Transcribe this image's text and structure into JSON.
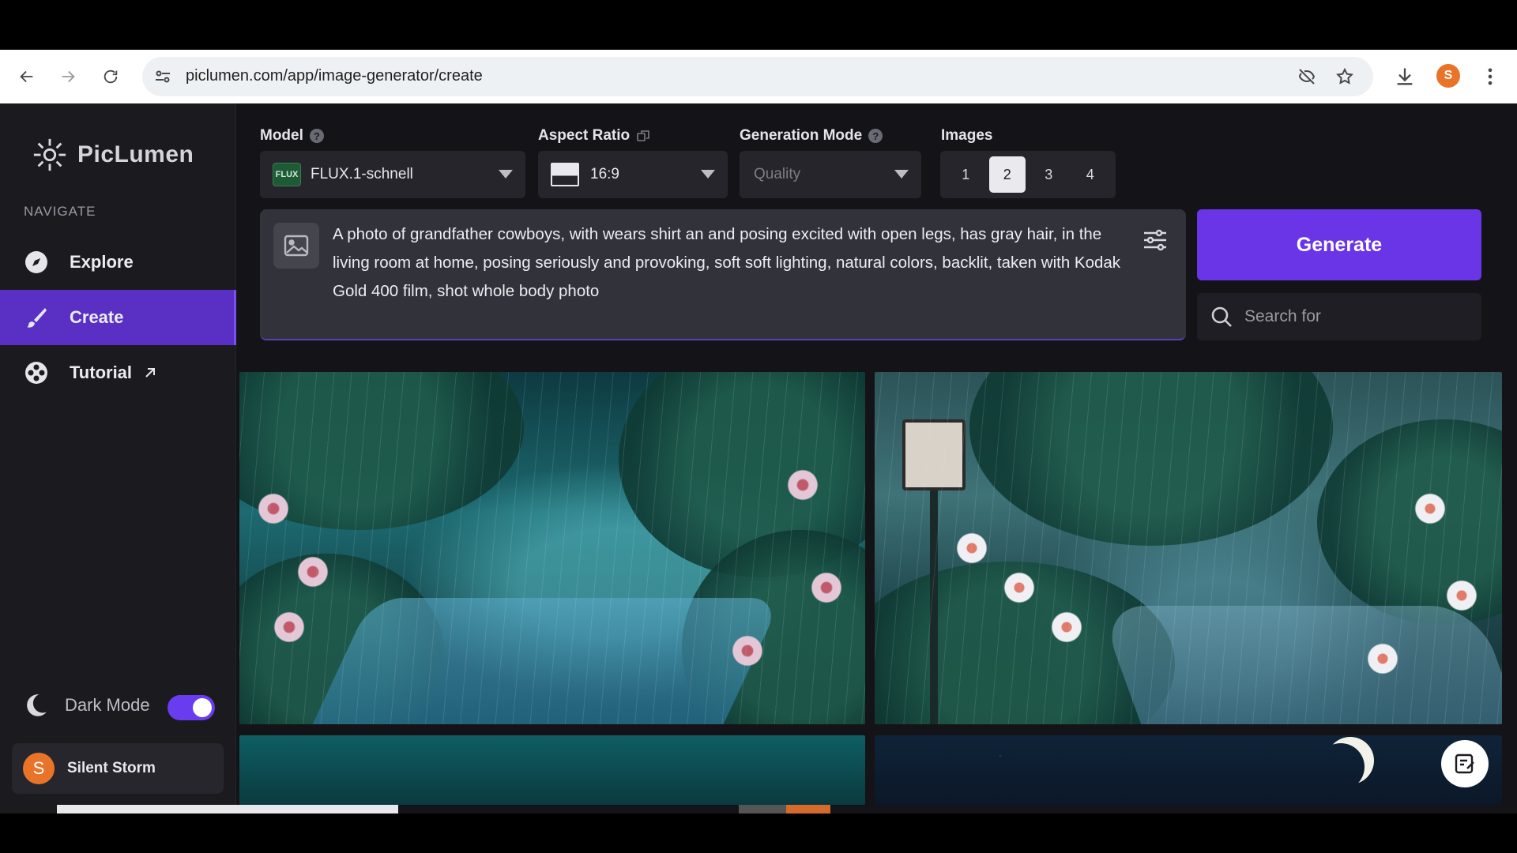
{
  "browser": {
    "url": "piclumen.com/app/image-generator/create",
    "profile_initial": "S"
  },
  "sidebar": {
    "logo_text": "PicLumen",
    "nav_heading": "NAVIGATE",
    "items": [
      {
        "label": "Explore",
        "icon": "compass-icon",
        "active": false
      },
      {
        "label": "Create",
        "icon": "brush-icon",
        "active": true
      },
      {
        "label": "Tutorial",
        "icon": "film-reel-icon",
        "active": false,
        "external": true
      }
    ],
    "dark_mode_label": "Dark Mode",
    "dark_mode_on": true,
    "user": {
      "initial": "S",
      "name": "Silent Storm"
    }
  },
  "controls": {
    "model": {
      "label": "Model",
      "badge": "FLUX",
      "value": "FLUX.1-schnell"
    },
    "aspect_ratio": {
      "label": "Aspect Ratio",
      "value": "16:9"
    },
    "generation_mode": {
      "label": "Generation Mode",
      "value": "Quality"
    },
    "images": {
      "label": "Images",
      "options": [
        "1",
        "2",
        "3",
        "4"
      ],
      "selected": "2"
    }
  },
  "prompt": {
    "text": "A photo of  grandfather cowboys, with wears shirt an and posing excited with open legs, has gray hair, in the living room at home, posing seriously and provoking, soft soft lighting, natural colors, backlit, taken with Kodak Gold 400 film, shot whole body photo"
  },
  "actions": {
    "generate_label": "Generate",
    "search_placeholder": "Search for"
  },
  "colors": {
    "accent": "#6a35e6",
    "sidebar_active": "#5a2fc4",
    "avatar": "#e8742a"
  }
}
